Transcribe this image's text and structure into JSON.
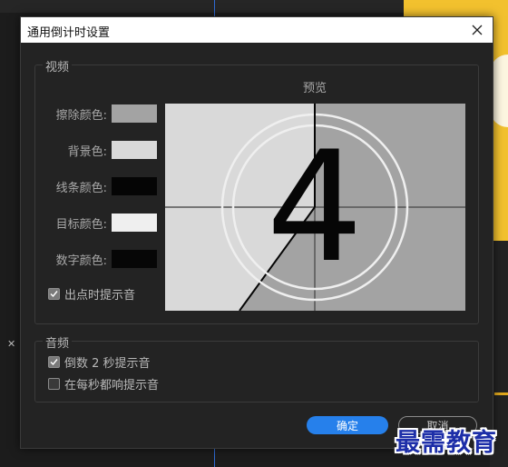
{
  "dialog": {
    "title": "通用倒计时设置",
    "ok_label": "确定",
    "cancel_label": "取消"
  },
  "video": {
    "group_label": "视频",
    "preview_label": "预览",
    "preview_number": "4",
    "colors": [
      {
        "label": "擦除颜色:",
        "color": "#a3a3a3"
      },
      {
        "label": "背景色:",
        "color": "#d9d9d9"
      },
      {
        "label": "线条颜色:",
        "color": "#050505"
      },
      {
        "label": "目标颜色:",
        "color": "#efefef"
      },
      {
        "label": "数字颜色:",
        "color": "#060606"
      }
    ],
    "cue_checkbox": {
      "label": "出点时提示音",
      "checked": true
    }
  },
  "audio": {
    "group_label": "音频",
    "options": [
      {
        "label": "倒数 2 秒提示音",
        "checked": true
      },
      {
        "label": "在每秒都响提示音",
        "checked": false
      }
    ]
  },
  "accent_color": "#2680eb",
  "watermark": "最需教育"
}
